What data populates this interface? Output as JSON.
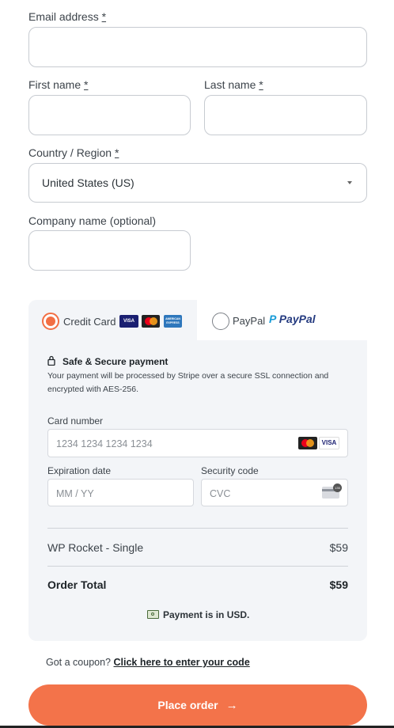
{
  "form": {
    "email_label": "Email address",
    "first_name_label": "First name",
    "last_name_label": "Last name",
    "country_label": "Country / Region",
    "country_value": "United States (US)",
    "company_label": "Company name (optional)",
    "required_mark": "*",
    "email_value": "",
    "first_name_value": "",
    "last_name_value": "",
    "company_value": ""
  },
  "payment": {
    "tabs": [
      {
        "label": "Credit Card",
        "selected": true
      },
      {
        "label": "PayPal",
        "selected": false
      }
    ],
    "paypal_logo_text": "PayPal",
    "card_badges": [
      "VISA",
      "mastercard",
      "AMERICAN EXPRESS"
    ],
    "secure_title": "Safe & Secure payment",
    "secure_desc": "Your payment will be processed by Stripe over a secure SSL connection and encrypted with AES-256.",
    "card_number_label": "Card number",
    "card_number_placeholder": "1234 1234 1234 1234",
    "expiry_label": "Expiration date",
    "expiry_placeholder": "MM / YY",
    "cvc_label": "Security code",
    "cvc_placeholder": "CVC",
    "cvc_icon_text": "135",
    "accent_color": "#f26f44"
  },
  "summary": {
    "product": "WP Rocket - Single",
    "product_price": "$59",
    "total_label": "Order Total",
    "total_price": "$59",
    "currency_note": "Payment is in USD."
  },
  "coupon": {
    "prompt": "Got a coupon?",
    "link": "Click here to enter your code"
  },
  "place_order": {
    "label": "Place order",
    "arrow": "→",
    "color": "#f3734a"
  }
}
